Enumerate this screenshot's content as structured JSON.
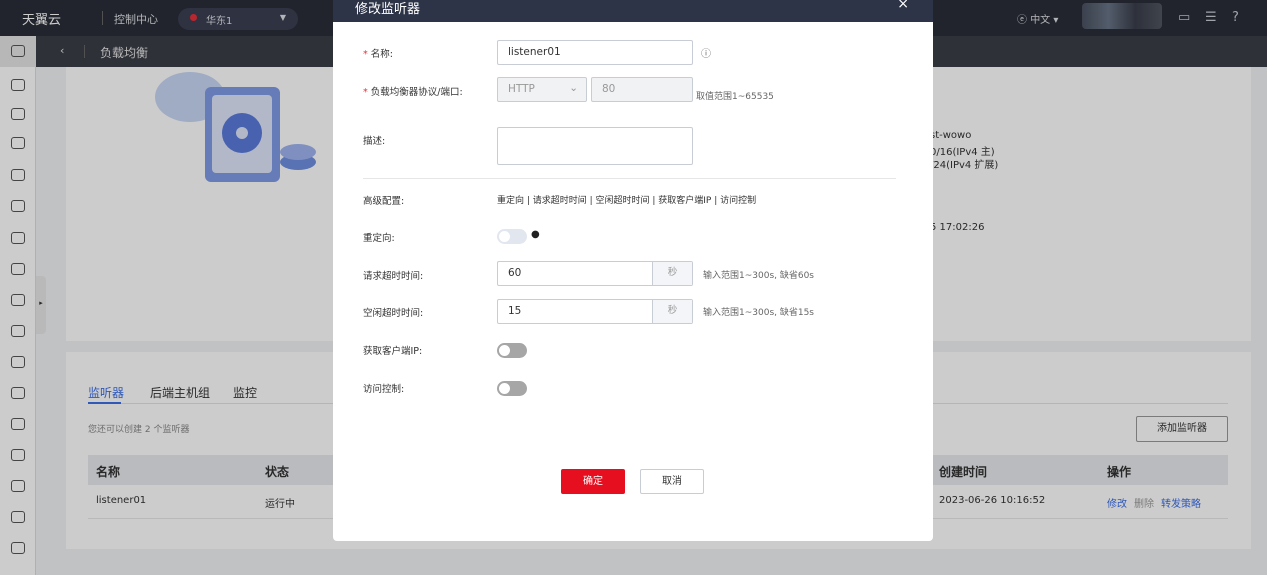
{
  "topbar": {
    "logo": "天翼云",
    "console": "控制中心",
    "region": "华东1",
    "lang": "中文"
  },
  "breadcrumb": {
    "title": "负载均衡"
  },
  "info": {
    "vpc": "st-wowo",
    "subnet1": "0/16(IPv4 主)",
    "subnet2": "/24(IPv4 扩展)",
    "time": "5 17:02:26"
  },
  "tabs": [
    "监听器",
    "后端主机组",
    "监控"
  ],
  "quota": "您还可以创建 2 个监听器",
  "add_button": "添加监听器",
  "table": {
    "headers": [
      "名称",
      "状态",
      "创建时间",
      "操作"
    ],
    "rows": [
      {
        "name": "listener01",
        "status": "运行中",
        "created": "2023-06-26 10:16:52",
        "actions": [
          "修改",
          "删除",
          "转发策略"
        ]
      }
    ]
  },
  "modal": {
    "title": "修改监听器",
    "close": "×",
    "name_label": "名称:",
    "name_value": "listener01",
    "proto_label": "负载均衡器协议/端口:",
    "protocol": "HTTP",
    "port": "80",
    "port_hint": "取值范围1~65535",
    "desc_label": "描述:",
    "desc_value": "",
    "adv_label": "高级配置:",
    "adv_links": "重定向 | 请求超时时间 | 空闲超时时间 | 获取客户端IP | 访问控制",
    "redirect_label": "重定向:",
    "redirect_on": false,
    "req_timeout_label": "请求超时时间:",
    "req_timeout": "60",
    "unit": "秒",
    "req_hint": "输入范围1~300s, 缺省60s",
    "idle_timeout_label": "空闲超时时间:",
    "idle_timeout": "15",
    "idle_hint": "输入范围1~300s, 缺省15s",
    "client_ip_label": "获取客户端IP:",
    "client_ip_on": false,
    "acl_label": "访问控制:",
    "acl_on": false,
    "ok": "确定",
    "cancel": "取消"
  }
}
